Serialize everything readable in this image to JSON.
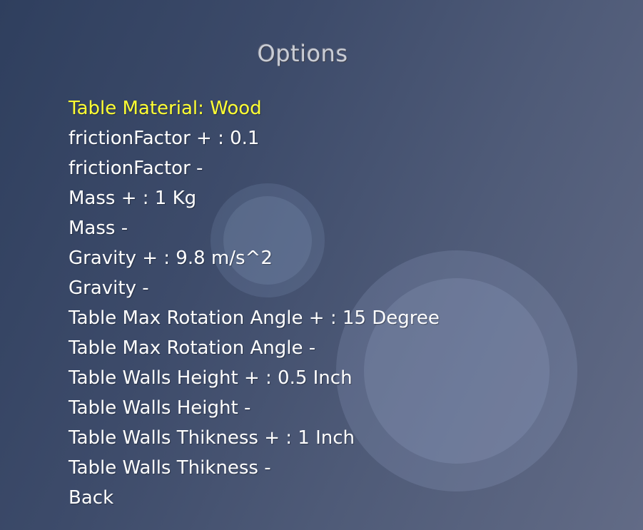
{
  "title": "Options",
  "colors": {
    "selected": "#ffff33",
    "normal": "#ffffff",
    "title": "#c9cdd6"
  },
  "menu": {
    "selected_index": 0,
    "items": [
      {
        "label": "Table Material: Wood"
      },
      {
        "label": "frictionFactor + : 0.1"
      },
      {
        "label": "frictionFactor -"
      },
      {
        "label": "Mass + : 1 Kg"
      },
      {
        "label": "Mass -"
      },
      {
        "label": "Gravity + : 9.8 m/s^2"
      },
      {
        "label": "Gravity -"
      },
      {
        "label": "Table Max Rotation Angle + : 15 Degree"
      },
      {
        "label": "Table Max Rotation Angle -"
      },
      {
        "label": "Table Walls Height + : 0.5 Inch"
      },
      {
        "label": "Table Walls Height -"
      },
      {
        "label": "Table Walls Thikness + : 1 Inch"
      },
      {
        "label": "Table Walls Thikness -"
      },
      {
        "label": "Back"
      }
    ]
  }
}
